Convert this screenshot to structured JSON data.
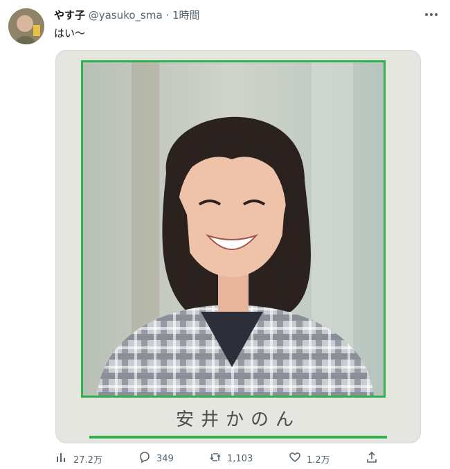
{
  "author": {
    "name": "やす子",
    "handle": "@yasuko_sma",
    "separator": "·",
    "time": "1時間"
  },
  "tweet": {
    "text": "はい〜"
  },
  "media": {
    "caption": "安井かのん"
  },
  "actions": {
    "views": "27.2万",
    "replies": "349",
    "retweets": "1,103",
    "likes": "1.2万"
  },
  "icons": {
    "more": "more-options-icon",
    "views": "analytics-icon",
    "reply": "reply-icon",
    "retweet": "retweet-icon",
    "like": "heart-icon",
    "share": "share-icon"
  },
  "colors": {
    "frame_green": "#2fb24b",
    "secondary_text": "#536471"
  }
}
